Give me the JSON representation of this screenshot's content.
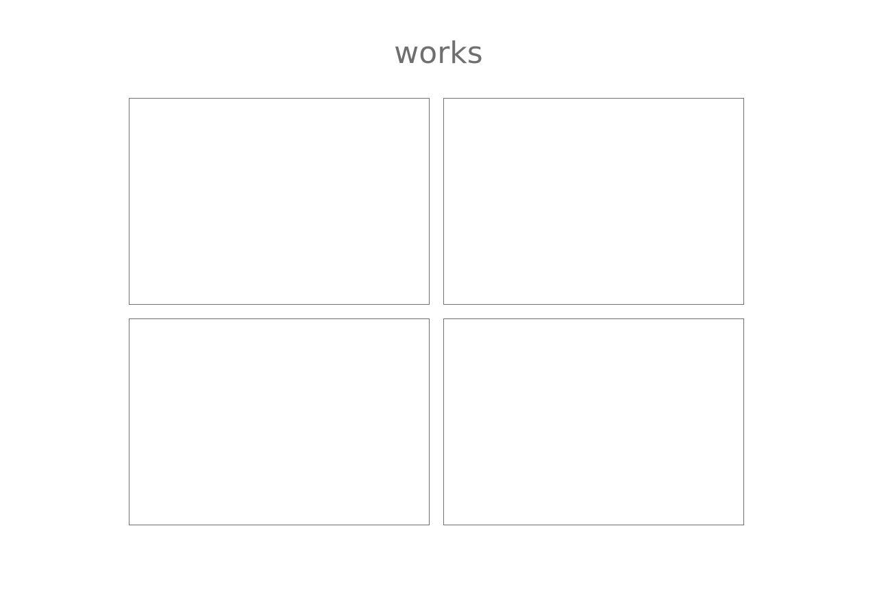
{
  "page": {
    "title": "works"
  },
  "works": {
    "items": [
      {
        "label": ""
      },
      {
        "label": ""
      },
      {
        "label": ""
      },
      {
        "label": ""
      }
    ]
  },
  "colors": {
    "title_text": "#6f6f6f",
    "card_border": "#6f6f6f",
    "background": "#ffffff"
  }
}
